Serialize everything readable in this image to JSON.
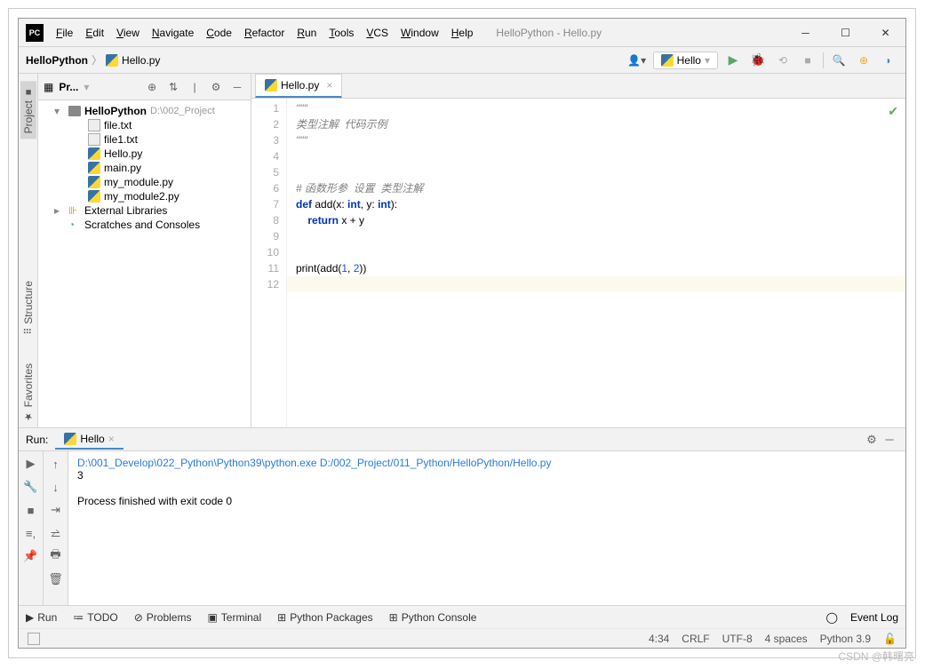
{
  "window": {
    "title": "HelloPython - Hello.py"
  },
  "menu": [
    "File",
    "Edit",
    "View",
    "Navigate",
    "Code",
    "Refactor",
    "Run",
    "Tools",
    "VCS",
    "Window",
    "Help"
  ],
  "breadcrumb": {
    "project": "HelloPython",
    "file": "Hello.py"
  },
  "run_config": "Hello",
  "project_panel": {
    "title": "Pr...",
    "root": {
      "name": "HelloPython",
      "path": "D:\\002_Project"
    },
    "files": [
      "file.txt",
      "file1.txt",
      "Hello.py",
      "main.py",
      "my_module.py",
      "my_module2.py"
    ],
    "ext_libs": "External Libraries",
    "scratches": "Scratches and Consoles"
  },
  "vtabs": {
    "project": "Project",
    "structure": "Structure",
    "favorites": "Favorites"
  },
  "editor": {
    "tab": "Hello.py",
    "lines": [
      {
        "n": 1,
        "html": "<span class='str'>\"\"\"</span>"
      },
      {
        "n": 2,
        "html": "<span class='str'>类型注解  代码示例</span>"
      },
      {
        "n": 3,
        "html": "<span class='str'>\"\"\"</span>"
      },
      {
        "n": 4,
        "html": ""
      },
      {
        "n": 5,
        "html": ""
      },
      {
        "n": 6,
        "html": "<span class='cmt'># 函数形参  设置  类型注解</span>"
      },
      {
        "n": 7,
        "html": "<span class='kw'>def</span> <span class='fn'>add</span>(x: <span class='kw'>int</span>, y: <span class='kw'>int</span>):"
      },
      {
        "n": 8,
        "html": "    <span class='kw'>return</span> x + y"
      },
      {
        "n": 9,
        "html": ""
      },
      {
        "n": 10,
        "html": ""
      },
      {
        "n": 11,
        "html": "print(add(<span class='num'>1</span>, <span class='num'>2</span>))"
      },
      {
        "n": 12,
        "html": ""
      }
    ]
  },
  "run_panel": {
    "label": "Run:",
    "tab": "Hello",
    "cmd": "D:\\001_Develop\\022_Python\\Python39\\python.exe D:/002_Project/011_Python/HelloPython/Hello.py",
    "output": "3",
    "exit": "Process finished with exit code 0"
  },
  "status_tabs": {
    "run": "Run",
    "todo": "TODO",
    "problems": "Problems",
    "terminal": "Terminal",
    "packages": "Python Packages",
    "console": "Python Console",
    "eventlog": "Event Log"
  },
  "status": {
    "pos": "4:34",
    "eol": "CRLF",
    "enc": "UTF-8",
    "indent": "4 spaces",
    "sdk": "Python 3.9"
  },
  "watermark": "CSDN @韩曙亮"
}
